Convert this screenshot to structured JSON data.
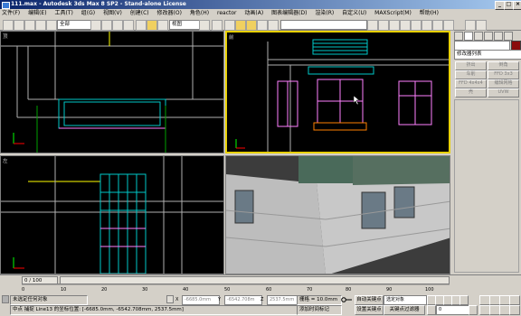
{
  "titlebar": {
    "title": "111.max - Autodesk 3ds Max 8 SP2 - Stand-alone License",
    "min": "_",
    "max": "□",
    "close": "×"
  },
  "menu": [
    "文件(F)",
    "编辑(E)",
    "工具(T)",
    "组(G)",
    "视图(V)",
    "创建(C)",
    "修改器(O)",
    "角色(H)",
    "reactor",
    "动画(A)",
    "图表编辑器(D)",
    "渲染(R)",
    "自定义(U)",
    "MAXScript(M)",
    "帮助(H)"
  ],
  "toolbar": {
    "selection_filter": "全部",
    "ref_coord": "视图",
    "named_selection": ""
  },
  "viewports": {
    "top": "顶",
    "front": "前",
    "left": "左",
    "persp": "透视"
  },
  "command_panel": {
    "name_field": "",
    "color": "#8a0c0c",
    "modifier_list": "修改器列表",
    "buttons": [
      [
        "挤出",
        "倒角"
      ],
      [
        "车削",
        "FFD 3x3"
      ],
      [
        "FFD 4x4x4",
        "编辑网格"
      ],
      [
        "壳",
        "UVW"
      ]
    ]
  },
  "timeline": {
    "frame_counter": "0 / 100",
    "ticks": [
      "0",
      "10",
      "20",
      "30",
      "40",
      "50",
      "60",
      "70",
      "80",
      "90",
      "100"
    ]
  },
  "status": {
    "selection": "未选定任何对象",
    "prompt": "中点 捕捉 Line13 的坐标位置: [-6685.0mm, -6542.708mm, 2537.5mm]",
    "x_field": "-6685.0mm",
    "y_field": "-6542.708m",
    "z_field": "2537.5mm",
    "grid": "栅格 = 10.0mm",
    "add_time_tag": "添加时间标记",
    "auto_key": "自动关键点",
    "set_key": "设置关键点",
    "selected_obj": "选定对象",
    "key_filters": "关键点过滤器",
    "frame_field": "0"
  }
}
